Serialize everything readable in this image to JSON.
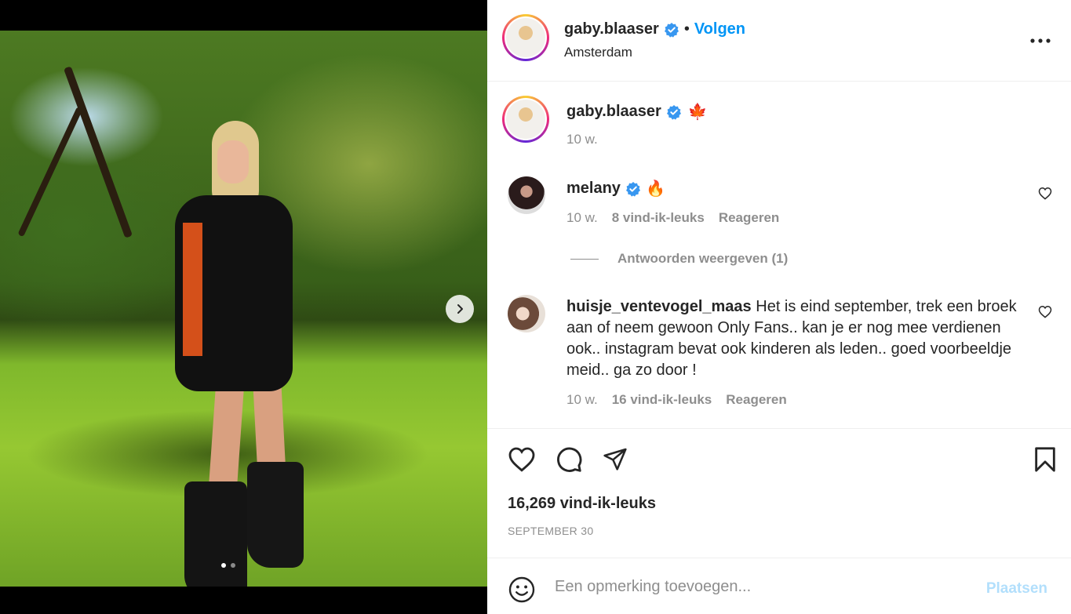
{
  "header": {
    "username": "gaby.blaaser",
    "separator": "•",
    "follow_label": "Volgen",
    "location": "Amsterdam"
  },
  "caption": {
    "username": "gaby.blaaser",
    "emoji": "🍁",
    "time": "10 w."
  },
  "comments": [
    {
      "username": "melany",
      "text": "🔥",
      "time": "10 w.",
      "likes": "8 vind-ik-leuks",
      "reply_label": "Reageren",
      "view_replies": "Antwoorden weergeven (1)"
    },
    {
      "username": "huisje_ventevogel_maas",
      "text": "Het is eind september, trek een broek aan of neem gewoon Only Fans.. kan je er nog mee verdienen ook.. instagram bevat ook kinderen als leden.. goed voorbeeldje meid.. ga zo door !",
      "time": "10 w.",
      "likes": "16 vind-ik-leuks",
      "reply_label": "Reageren"
    }
  ],
  "post": {
    "likes": "16,269 vind-ik-leuks",
    "date": "SEPTEMBER 30",
    "carousel_count": 2,
    "carousel_active": 1
  },
  "add_comment": {
    "placeholder": "Een opmerking toevoegen...",
    "post_label": "Plaatsen"
  },
  "colors": {
    "accent": "#0095f6",
    "verified": "#3897f0",
    "muted": "#8e8e8e",
    "post_disabled": "#b2dffc"
  }
}
